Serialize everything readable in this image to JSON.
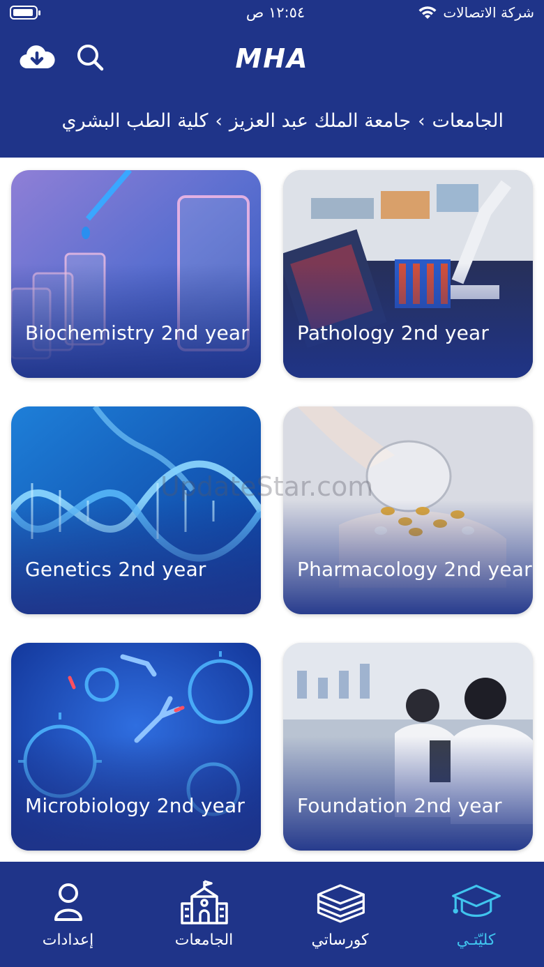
{
  "status_bar": {
    "time": "١٢:٥٤ ص",
    "carrier": "شركة الاتصالات"
  },
  "header": {
    "logo_text": "MHA",
    "breadcrumb": [
      "الجامعات",
      "جامعة الملك عبد العزيز",
      "كلية الطب البشري"
    ],
    "breadcrumb_separator": "›"
  },
  "courses": [
    {
      "title": "Biochemistry 2nd year"
    },
    {
      "title": "Pathology 2nd year"
    },
    {
      "title": "Genetics 2nd year"
    },
    {
      "title": "Pharmacology 2nd year"
    },
    {
      "title": "Microbiology 2nd year"
    },
    {
      "title": "Foundation 2nd year"
    }
  ],
  "watermark": "UpdateStar.com",
  "tabbar": {
    "items": [
      {
        "label": "إعدادات",
        "icon": "person-icon"
      },
      {
        "label": "الجامعات",
        "icon": "university-building-icon"
      },
      {
        "label": "كورساتي",
        "icon": "books-stack-icon"
      },
      {
        "label": "كليّتـي",
        "icon": "graduation-cap-icon",
        "active": true
      }
    ]
  },
  "colors": {
    "primary": "#1f3489",
    "active_tab": "#40c4ee",
    "text_on_primary": "#ffffff"
  }
}
